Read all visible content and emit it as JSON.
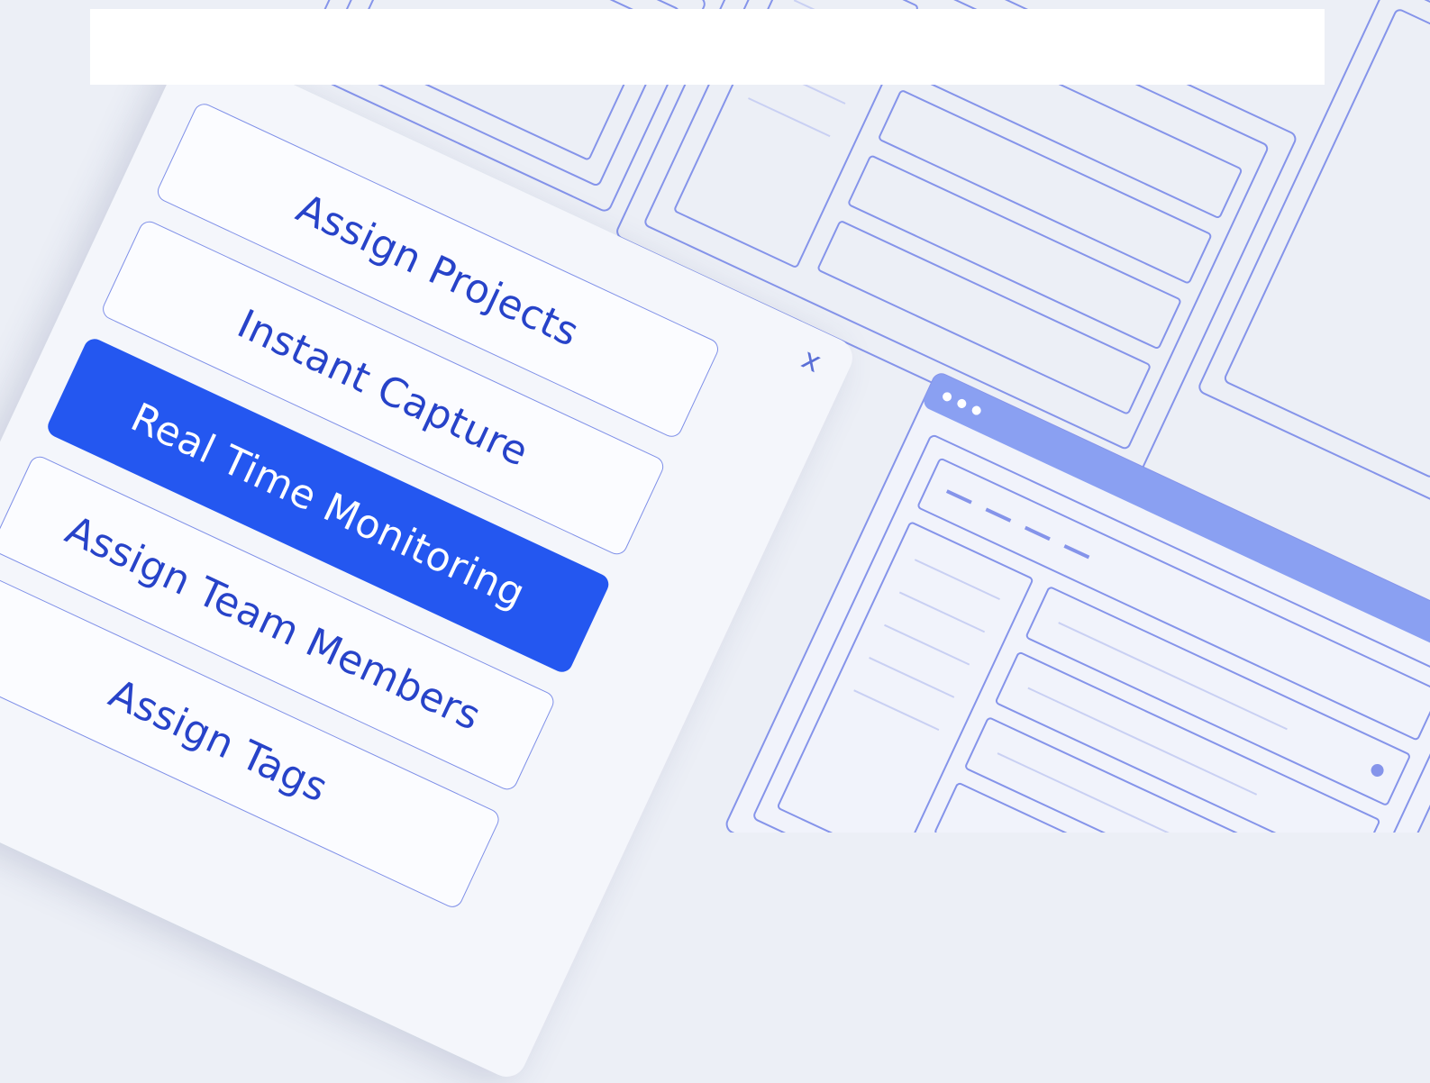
{
  "modal": {
    "close_label": "x",
    "items": [
      {
        "label": "Assign Projects",
        "active": false
      },
      {
        "label": "Instant Capture",
        "active": false
      },
      {
        "label": "Real Time Monitoring",
        "active": true
      },
      {
        "label": "Assign Team Members",
        "active": false
      },
      {
        "label": "Assign Tags",
        "active": false
      }
    ]
  },
  "colors": {
    "background": "#eceff6",
    "wireframe_stroke": "#8594ea",
    "accent": "#2457f0",
    "text": "#2743c9"
  },
  "icons": {
    "close": "close-icon",
    "window_dots": "window-controls-icon"
  }
}
